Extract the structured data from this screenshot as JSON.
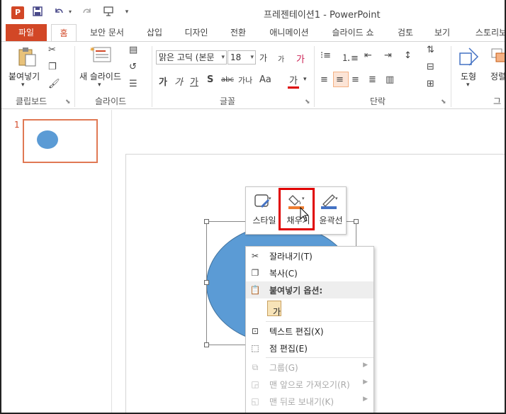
{
  "window": {
    "app_logo": "P",
    "title": "프레젠테이션1 - PowerPoint"
  },
  "quick_access": {
    "save_icon": "save-icon",
    "undo_icon": "undo-icon",
    "redo_icon": "redo-icon",
    "presenter_icon": "presenter-icon",
    "customize_icon": "customize-icon"
  },
  "tabs": [
    {
      "label": "파일"
    },
    {
      "label": "홈"
    },
    {
      "label": "보안 문서"
    },
    {
      "label": "삽입"
    },
    {
      "label": "디자인"
    },
    {
      "label": "전환"
    },
    {
      "label": "애니메이션"
    },
    {
      "label": "슬라이드 쇼"
    },
    {
      "label": "검토"
    },
    {
      "label": "보기"
    },
    {
      "label": "스토리보"
    }
  ],
  "ribbon": {
    "clipboard": {
      "paste_label": "붙여넣기",
      "group_label": "클립보드"
    },
    "slides": {
      "new_slide_label": "새 슬라이드",
      "group_label": "슬라이드"
    },
    "font": {
      "font_name": "맑은 고딕 (본문",
      "font_size": "18",
      "bold": "가",
      "italic": "가",
      "underline": "가",
      "shadow": "S",
      "strike": "abc",
      "spacing": "가나",
      "case": "Aa",
      "color": "가",
      "grow": "가",
      "shrink": "가",
      "clear": "가",
      "group_label": "글꼴"
    },
    "paragraph": {
      "group_label": "단락"
    },
    "drawing": {
      "shapes_label": "도형",
      "arrange_label": "정렬",
      "group_label": "그"
    }
  },
  "thumbnails": {
    "slide_number": "1"
  },
  "mini_toolbar": {
    "style_label": "스타일",
    "fill_label": "채우기",
    "outline_label": "윤곽선"
  },
  "context_menu": {
    "items": [
      {
        "label": "잘라내기(T)",
        "icon": "scissors-icon",
        "enabled": true
      },
      {
        "label": "복사(C)",
        "icon": "copy-icon",
        "enabled": true
      },
      {
        "label": "붙여넣기 옵션:",
        "icon": "paste-icon",
        "enabled": true
      },
      {
        "label": "가",
        "icon": "paste-keep-text-icon",
        "enabled": true
      },
      {
        "label": "텍스트 편집(X)",
        "icon": "edit-text-icon",
        "enabled": true
      },
      {
        "label": "점 편집(E)",
        "icon": "edit-points-icon",
        "enabled": true
      },
      {
        "label": "그룹(G)",
        "icon": "group-icon",
        "enabled": false
      },
      {
        "label": "맨 앞으로 가져오기(R)",
        "icon": "bring-front-icon",
        "enabled": false
      },
      {
        "label": "맨 뒤로 보내기(K)",
        "icon": "send-back-icon",
        "enabled": false
      }
    ]
  },
  "colors": {
    "accent": "#d24726",
    "shape_fill": "#5b9bd5",
    "highlight": "#e00000",
    "fill_bar": "#ed7d31",
    "outline_bar": "#4472c4"
  }
}
